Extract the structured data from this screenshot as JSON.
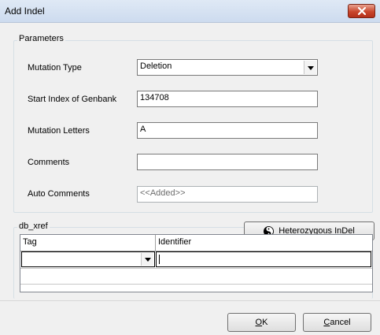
{
  "window": {
    "title": "Add Indel"
  },
  "parameters": {
    "legend": "Parameters",
    "mutation_type": {
      "label": "Mutation Type",
      "value": "Deletion"
    },
    "start_index": {
      "label": "Start Index of Genbank",
      "value": "134708"
    },
    "mutation_letters": {
      "label": "Mutation Letters",
      "value": "A"
    },
    "comments": {
      "label": "Comments",
      "value": ""
    },
    "auto_comments": {
      "label": "Auto Comments",
      "value": "<<Added>>"
    }
  },
  "db_xref": {
    "legend": "db_xref",
    "columns": [
      "Tag",
      "Identifier"
    ],
    "rows": [
      {
        "tag": "",
        "identifier": ""
      }
    ]
  },
  "buttons": {
    "heterozygous": "Heterozygous InDel",
    "ok_mnemonic": "O",
    "ok_rest": "K",
    "cancel_mnemonic": "C",
    "cancel_rest": "ancel"
  },
  "icons": {
    "close": "close-icon",
    "dropdown": "chevron-down-icon",
    "yin_yang": "yin-yang-icon"
  },
  "colors": {
    "close_button": "#c9462c",
    "title_bar": "#dfe9f5",
    "dialog_bg": "#f0f0f0"
  }
}
